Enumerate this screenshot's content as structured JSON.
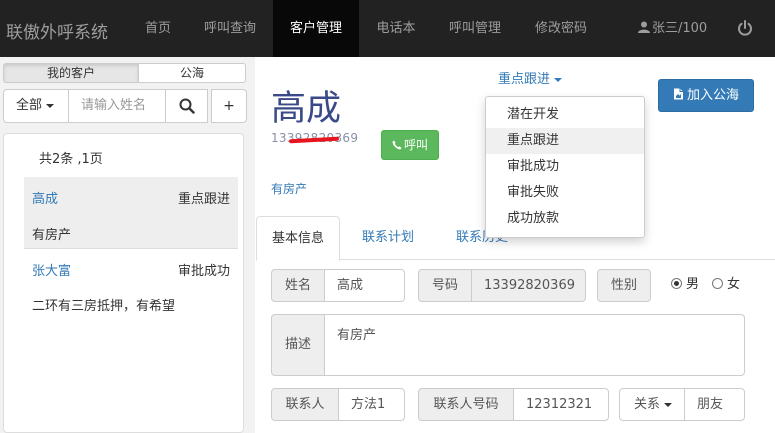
{
  "navbar": {
    "brand": "联傲外呼系统",
    "items": [
      "首页",
      "呼叫查询",
      "客户管理",
      "电话本",
      "呼叫管理",
      "修改密码"
    ],
    "active_item": "客户管理",
    "user": "张三/100",
    "colors": {
      "background": "#222222",
      "active": "#080808"
    }
  },
  "sidebar": {
    "tabs": [
      "我的客户",
      "公海"
    ],
    "filter_label": "全部",
    "search_placeholder": "请输入姓名",
    "add_label": "+",
    "count_text": "共2条 ,1页",
    "customers": [
      {
        "name": "高成",
        "status": "重点跟进",
        "desc": "有房产"
      },
      {
        "name": "张大富",
        "status": "审批成功",
        "desc": "二环有三房抵押，有希望"
      }
    ]
  },
  "detail": {
    "name": "高成",
    "phone": "13392820369",
    "call_label": "呼叫",
    "tag": "有房产",
    "status": "重点跟进",
    "status_options": [
      "潜在开发",
      "重点跟进",
      "审批成功",
      "审批失败",
      "成功放款"
    ],
    "highlighted_option": "重点跟进",
    "pool_button": "加入公海",
    "tabs": [
      "基本信息",
      "联系计划",
      "联系历史"
    ],
    "form": {
      "name_label": "姓名",
      "name_value": "高成",
      "phone_label": "号码",
      "phone_value": "13392820369",
      "gender_label": "性别",
      "gender_options": [
        "男",
        "女"
      ],
      "gender_selected": "男",
      "desc_label": "描述",
      "desc_value": "有房产",
      "contact_label": "联系人",
      "contact_value": "方法1",
      "contact_phone_label": "联系人号码",
      "contact_phone_value": "12312321",
      "relation_label": "关系",
      "relation_value": "朋友"
    }
  },
  "colors": {
    "primary": "#337ab7",
    "success": "#5cb85c",
    "title": "#3a4a88",
    "redaction": "#e8141e"
  }
}
